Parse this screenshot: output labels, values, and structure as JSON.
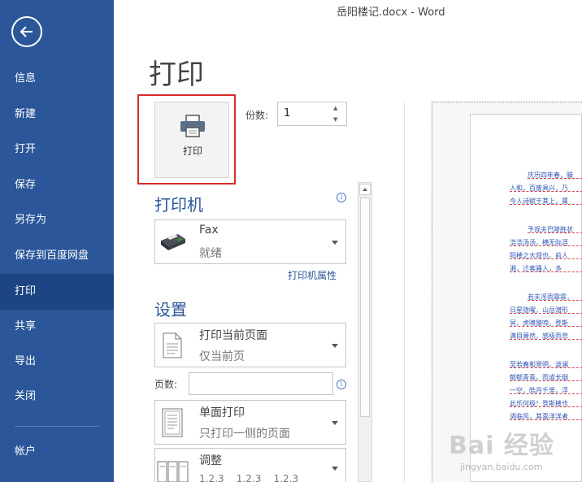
{
  "window": {
    "title": "岳阳楼记.docx - Word"
  },
  "sidebar": {
    "items": [
      {
        "label": "信息"
      },
      {
        "label": "新建"
      },
      {
        "label": "打开"
      },
      {
        "label": "保存"
      },
      {
        "label": "另存为"
      },
      {
        "label": "保存到百度网盘"
      },
      {
        "label": "打印"
      },
      {
        "label": "共享"
      },
      {
        "label": "导出"
      },
      {
        "label": "关闭"
      },
      {
        "label": "帐户"
      }
    ],
    "active": "打印"
  },
  "print": {
    "page_title": "打印",
    "button_label": "打印",
    "copies_label": "份数:",
    "copies_value": "1"
  },
  "printer": {
    "section_title": "打印机",
    "name": "Fax",
    "status": "就绪",
    "properties_link": "打印机属性"
  },
  "settings": {
    "section_title": "设置",
    "range": {
      "main": "打印当前页面",
      "sub": "仅当前页"
    },
    "pages_label": "页数:",
    "pages_value": "",
    "sides": {
      "main": "单面打印",
      "sub": "只打印一侧的页面"
    },
    "collate": {
      "main": "调整",
      "sub": "1,2,3    1,2,3    1,2,3"
    }
  },
  "preview": {
    "lines": [
      "庆历四年春，滕",
      "人和，百废具兴，乃",
      "今人诗赋于其上，属",
      "予观夫巴陵胜状",
      "浩浩汤汤，横无际涯",
      "阳楼之大观也，前人",
      "湘，迁客骚人，多",
      "若夫淫雨霏霏，",
      "日星隐曜，山岳潜形",
      "冥，虎啸猿啼。登斯",
      "满目萧然，感极而悲",
      "至若春和景明，波澜",
      "郁郁青青。而或长烟",
      "一空，皓月千里，浮",
      "此乐何极！登斯楼也",
      "酒临风，其喜洋洋者"
    ]
  },
  "watermark": {
    "main": "Bai 经验",
    "sub": "jingyan.baidu.com"
  },
  "colors": {
    "sidebar": "#2b579a",
    "sidebar_active": "#1d4583",
    "highlight": "#d72b2b"
  }
}
